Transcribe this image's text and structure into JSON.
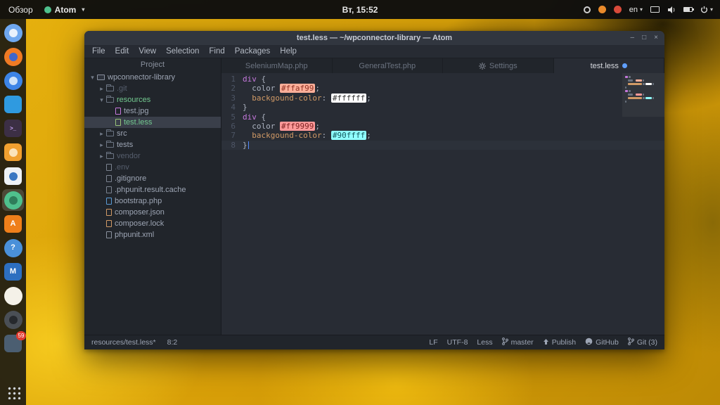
{
  "topbar": {
    "activities": "Обзор",
    "app_name": "Atom",
    "clock": "Вт, 15:52",
    "indicators": [
      {
        "name": "status-ring-icon",
        "type": "ring"
      },
      {
        "name": "status-orange-icon",
        "type": "dot",
        "color": "#e98a2b"
      },
      {
        "name": "status-red-icon",
        "type": "dot",
        "color": "#d84a3a"
      },
      {
        "name": "keyboard-indicator",
        "type": "text",
        "label": "en",
        "chevron": true
      },
      {
        "name": "display-icon",
        "type": "display"
      },
      {
        "name": "volume-icon",
        "type": "volume"
      },
      {
        "name": "battery-icon",
        "type": "battery"
      },
      {
        "name": "power-icon",
        "type": "power",
        "chevron": true
      }
    ]
  },
  "dock": {
    "items": [
      {
        "name": "chromium-browser",
        "shape": "circle",
        "bg": "#6fa8ef",
        "inner": "#e8f1fc"
      },
      {
        "name": "firefox",
        "shape": "circle",
        "bg": "#f07b24",
        "inner": "#3f66cc"
      },
      {
        "name": "thunderbird",
        "shape": "circle",
        "bg": "#3d84e6",
        "inner": "#cfe2f8"
      },
      {
        "name": "vscode",
        "shape": "rounded",
        "bg": "#2f9ae0"
      },
      {
        "name": "terminal",
        "shape": "rounded",
        "bg": "#3c2f45",
        "letter": ">_",
        "fg": "#cba6f7"
      },
      {
        "name": "image-tool",
        "shape": "rounded",
        "bg": "#f0a030",
        "inner": "#fbe3bb"
      },
      {
        "name": "libreoffice-writer",
        "shape": "rounded",
        "bg": "#eef2f6",
        "inner": "#3a77c2"
      },
      {
        "name": "atom",
        "shape": "circle",
        "bg": "#4fc08d",
        "inner": "#2f7d5a",
        "active": true
      },
      {
        "name": "app-a",
        "shape": "rounded",
        "bg": "#ef7f1a",
        "letter": "A",
        "fg": "#ffffff"
      },
      {
        "name": "help",
        "shape": "circle",
        "bg": "#4a90d9",
        "letter": "?",
        "fg": "#ffffff"
      },
      {
        "name": "monitor-app",
        "shape": "rounded",
        "bg": "#2d6fc0",
        "letter": "M",
        "fg": "#ffffff"
      },
      {
        "name": "egg-app",
        "shape": "circle",
        "bg": "#f4f1e8"
      },
      {
        "name": "dark-app",
        "shape": "circle",
        "bg": "#4a4f55",
        "inner": "#26292d"
      },
      {
        "name": "chat-app",
        "shape": "rounded",
        "bg": "#4b5e71",
        "badge": "59"
      }
    ],
    "show_applications": "show-applications"
  },
  "window": {
    "title": "test.less — ~/wpconnector-library — Atom",
    "controls": [
      {
        "name": "window-minimize-button",
        "glyph": "–"
      },
      {
        "name": "window-maximize-button",
        "glyph": "□"
      },
      {
        "name": "window-close-button",
        "glyph": "×"
      }
    ]
  },
  "menu": [
    "File",
    "Edit",
    "View",
    "Selection",
    "Find",
    "Packages",
    "Help"
  ],
  "tree": {
    "header": "Project",
    "items": [
      {
        "label": "wpconnector-library",
        "level": 0,
        "chevron": "down",
        "icon": "repo"
      },
      {
        "label": ".git",
        "level": 1,
        "chevron": "right",
        "icon": "folder",
        "dim": true
      },
      {
        "label": "resources",
        "level": 1,
        "chevron": "down",
        "icon": "folder",
        "git": "added"
      },
      {
        "label": "test.jpg",
        "level": 2,
        "icon": "image"
      },
      {
        "label": "test.less",
        "level": 2,
        "icon": "less",
        "selected": true,
        "git": "added"
      },
      {
        "label": "src",
        "level": 1,
        "chevron": "right",
        "icon": "folder"
      },
      {
        "label": "tests",
        "level": 1,
        "chevron": "right",
        "icon": "folder"
      },
      {
        "label": "vendor",
        "level": 1,
        "chevron": "right",
        "icon": "folder",
        "dim": true
      },
      {
        "label": ".env",
        "level": 1,
        "icon": "file",
        "dim": true
      },
      {
        "label": ".gitignore",
        "level": 1,
        "icon": "file"
      },
      {
        "label": ".phpunit.result.cache",
        "level": 1,
        "icon": "file"
      },
      {
        "label": "bootstrap.php",
        "level": 1,
        "icon": "php"
      },
      {
        "label": "composer.json",
        "level": 1,
        "icon": "json"
      },
      {
        "label": "composer.lock",
        "level": 1,
        "icon": "json"
      },
      {
        "label": "phpunit.xml",
        "level": 1,
        "icon": "xml"
      }
    ]
  },
  "tabs": [
    {
      "label": "SeleniumMap.php"
    },
    {
      "label": "GeneralTest.php"
    },
    {
      "label": "Settings",
      "icon": "gear"
    },
    {
      "label": "test.less",
      "active": true,
      "modified": true
    }
  ],
  "editor": {
    "lines": [
      {
        "n": "1",
        "tokens": [
          {
            "t": "div",
            "c": "sel"
          },
          {
            "t": " {",
            "c": "pln"
          }
        ]
      },
      {
        "n": "2",
        "tokens": [
          {
            "t": "  ",
            "c": "pln"
          },
          {
            "t": "color",
            "c": "pln"
          },
          {
            "t": " ",
            "c": "pln"
          },
          {
            "t": "#ffaf99",
            "c": "swatch",
            "bg": "#ffaf99",
            "fg": "#8c3123"
          },
          {
            "t": ";",
            "c": "pln"
          }
        ]
      },
      {
        "n": "3",
        "tokens": [
          {
            "t": "  ",
            "c": "pln"
          },
          {
            "t": "backgound-color",
            "c": "prop"
          },
          {
            "t": ": ",
            "c": "pln"
          },
          {
            "t": "#ffffff",
            "c": "swatch",
            "bg": "#ffffff",
            "fg": "#333333"
          },
          {
            "t": ";",
            "c": "pln"
          }
        ]
      },
      {
        "n": "4",
        "tokens": [
          {
            "t": "}",
            "c": "pln"
          }
        ]
      },
      {
        "n": "5",
        "tokens": [
          {
            "t": "div",
            "c": "sel"
          },
          {
            "t": " {",
            "c": "pln"
          }
        ]
      },
      {
        "n": "6",
        "tokens": [
          {
            "t": "  ",
            "c": "pln"
          },
          {
            "t": "color",
            "c": "pln"
          },
          {
            "t": " ",
            "c": "pln"
          },
          {
            "t": "#ff9999",
            "c": "swatch",
            "bg": "#ff9999",
            "fg": "#7a1f1f"
          },
          {
            "t": ";",
            "c": "pln"
          }
        ]
      },
      {
        "n": "7",
        "tokens": [
          {
            "t": "  ",
            "c": "pln"
          },
          {
            "t": "backgound-color",
            "c": "prop"
          },
          {
            "t": ": ",
            "c": "pln"
          },
          {
            "t": "#90ffff",
            "c": "swatch",
            "bg": "#90ffff",
            "fg": "#14585d"
          },
          {
            "t": ";",
            "c": "pln"
          }
        ]
      },
      {
        "n": "8",
        "active": true,
        "tokens": [
          {
            "t": "}",
            "c": "pln"
          },
          {
            "c": "cursor"
          }
        ]
      }
    ]
  },
  "status": {
    "left": [
      {
        "name": "file-path",
        "label": "resources/test.less*"
      },
      {
        "name": "cursor-position",
        "label": "8:2"
      }
    ],
    "right": [
      {
        "name": "line-ending",
        "label": "LF"
      },
      {
        "name": "encoding",
        "label": "UTF-8"
      },
      {
        "name": "grammar",
        "label": "Less"
      },
      {
        "name": "git-branch",
        "icon": "branch",
        "label": "master"
      },
      {
        "name": "github-publish",
        "icon": "up",
        "label": "Publish"
      },
      {
        "name": "github-panel",
        "icon": "github",
        "label": "GitHub"
      },
      {
        "name": "git-panel",
        "icon": "branch",
        "label": "Git (3)"
      }
    ]
  }
}
